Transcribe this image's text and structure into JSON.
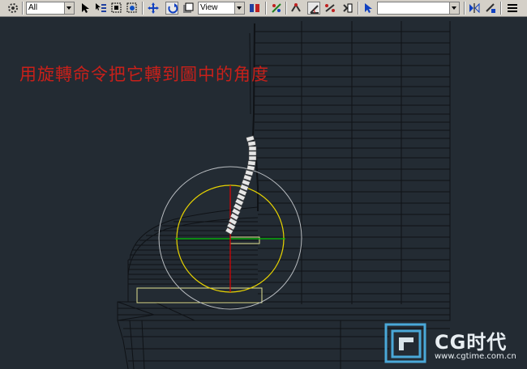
{
  "toolbar": {
    "selection_filter": "All",
    "reference_coord": "View",
    "named_selection": ""
  },
  "viewport": {
    "instruction": "用旋轉命令把它轉到圖中的角度"
  },
  "watermark": {
    "brand": "CG时代",
    "url": "www.cgtime.com.cn"
  },
  "colors": {
    "viewport_bg": "#232b33",
    "wire": "#0f1216",
    "gizmo_yellow": "#e8d400",
    "gizmo_red": "#e00000",
    "gizmo_green": "#00c000",
    "instruction_red": "#c8201a"
  }
}
